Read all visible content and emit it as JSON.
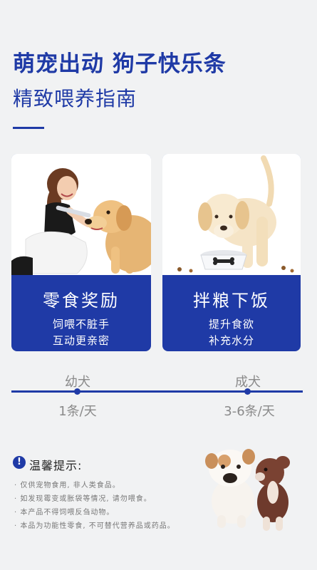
{
  "header": {
    "title": "萌宠出动 狗子快乐条",
    "subtitle": "精致喂养指南"
  },
  "cards": [
    {
      "title": "零食奖励",
      "line1": "饲喂不脏手",
      "line2": "互动更亲密"
    },
    {
      "title": "拌粮下饭",
      "line1": "提升食欲",
      "line2": "补充水分"
    }
  ],
  "timeline": {
    "left_label": "幼犬",
    "left_amount": "1条/天",
    "right_label": "成犬",
    "right_amount": "3-6条/天"
  },
  "tips": {
    "icon": "exclamation-icon",
    "title": "温馨提示:",
    "lines": [
      "· 仅供宠物食用, 非人类食品。",
      "· 如发现霉变或胀袋等情况, 请勿喂食。",
      "· 本产品不得饲喂反刍动物。",
      "· 本品为功能性零食, 不可替代营养品或药品。"
    ]
  },
  "colors": {
    "accent": "#1f3aa6",
    "background": "#f1f2f3"
  }
}
